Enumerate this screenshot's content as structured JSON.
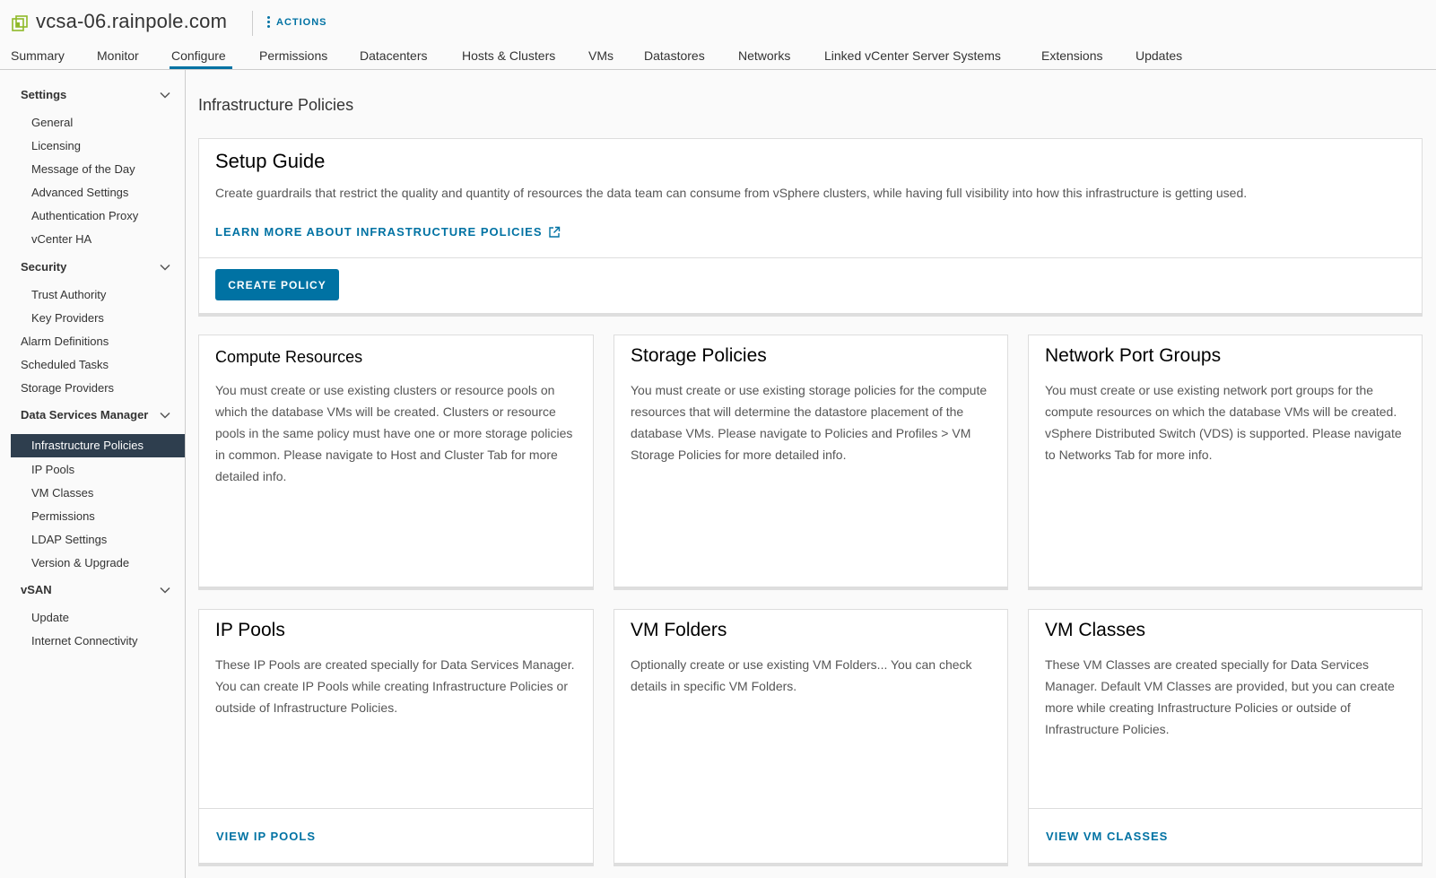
{
  "header": {
    "title": "vcsa-06.rainpole.com",
    "actions_label": "ACTIONS"
  },
  "tabs": [
    {
      "label": "Summary"
    },
    {
      "label": "Monitor"
    },
    {
      "label": "Configure",
      "active": true
    },
    {
      "label": "Permissions"
    },
    {
      "label": "Datacenters"
    },
    {
      "label": "Hosts & Clusters"
    },
    {
      "label": "VMs"
    },
    {
      "label": "Datastores"
    },
    {
      "label": "Networks"
    },
    {
      "label": "Linked vCenter Server Systems"
    },
    {
      "label": "Extensions"
    },
    {
      "label": "Updates"
    }
  ],
  "sidebar": {
    "settings": {
      "label": "Settings",
      "items": [
        "General",
        "Licensing",
        "Message of the Day",
        "Advanced Settings",
        "Authentication Proxy",
        "vCenter HA"
      ]
    },
    "security": {
      "label": "Security",
      "items": [
        "Trust Authority",
        "Key Providers"
      ]
    },
    "alarm_definitions": "Alarm Definitions",
    "scheduled_tasks": "Scheduled Tasks",
    "storage_providers": "Storage Providers",
    "dsm": {
      "label": "Data Services Manager",
      "items": [
        "Infrastructure Policies",
        "IP Pools",
        "VM Classes",
        "Permissions",
        "LDAP Settings",
        "Version & Upgrade"
      ],
      "selected": "Infrastructure Policies"
    },
    "vsan": {
      "label": "vSAN",
      "items": [
        "Update",
        "Internet Connectivity"
      ]
    }
  },
  "main": {
    "page_title": "Infrastructure Policies",
    "setup": {
      "title": "Setup Guide",
      "description": "Create guardrails that restrict the quality and quantity of resources the data team can consume from vSphere clusters, while having full visibility into how this infrastructure is getting used.",
      "learn_more": "LEARN MORE ABOUT INFRASTRUCTURE POLICIES",
      "create_button": "CREATE POLICY"
    },
    "cards": {
      "compute": {
        "title": "Compute Resources",
        "body": "You must create or use existing clusters or resource pools on which the database VMs will be created. Clusters or resource pools in the same policy must have one or more storage policies in common. Please navigate to Host and Cluster Tab for more detailed info."
      },
      "storage": {
        "title": "Storage Policies",
        "body": "You must create or use existing storage policies for the compute resources that will determine the datastore placement of the database VMs. Please navigate to Policies and Profiles > VM Storage Policies for more detailed info."
      },
      "network": {
        "title": "Network Port Groups",
        "body": "You must create or use existing network port groups for the compute resources on which the database VMs will be created. vSphere Distributed Switch (VDS) is supported. Please navigate to Networks Tab for more info."
      },
      "ip_pools": {
        "title": "IP Pools",
        "body": "These IP Pools are created specially for Data Services Manager. You can create IP Pools while creating Infrastructure Policies or outside of Infrastructure Policies.",
        "link": "VIEW IP POOLS"
      },
      "vm_folders": {
        "title": "VM Folders",
        "body": "Optionally create or use existing VM Folders... You can check details in specific VM Folders."
      },
      "vm_classes": {
        "title": "VM Classes",
        "body": "These VM Classes are created specially for Data Services Manager. Default VM Classes are provided, but you can create more while creating Infrastructure Policies or outside of Infrastructure Policies.",
        "link": "VIEW VM CLASSES"
      }
    }
  },
  "colors": {
    "accent": "#0072a3",
    "sidebar_selected_bg": "#2e3e4e",
    "vcenter_icon": "#8fb929"
  },
  "icons": {
    "header": "vcenter-icon",
    "actions": "kebab-icon",
    "section_toggle": "chevron-down-icon",
    "external_link": "external-link-icon"
  }
}
